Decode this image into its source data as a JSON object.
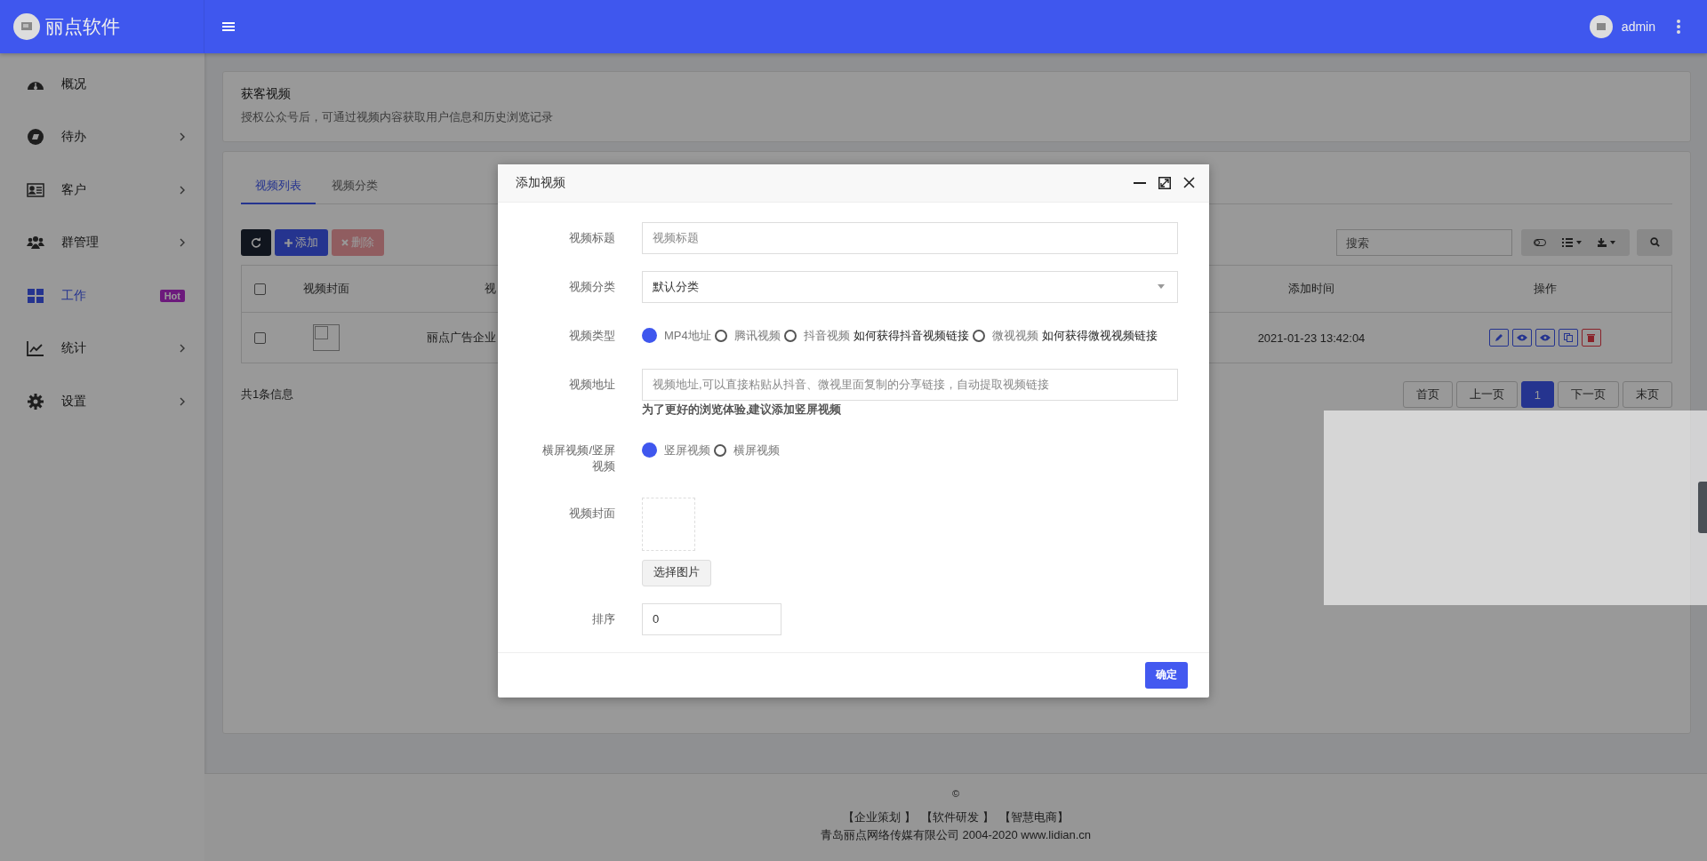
{
  "brand": {
    "name": "丽点软件"
  },
  "user": {
    "name": "admin"
  },
  "sidebar": {
    "items": [
      {
        "label": "概况",
        "kind": "gauge",
        "selected": false,
        "expandable": false
      },
      {
        "label": "待办",
        "kind": "compass",
        "selected": false,
        "expandable": true
      },
      {
        "label": "客户",
        "kind": "card",
        "selected": false,
        "expandable": true
      },
      {
        "label": "群管理",
        "kind": "users",
        "selected": false,
        "expandable": true
      },
      {
        "label": "工作",
        "kind": "grid",
        "selected": true,
        "expandable": false,
        "badge": "Hot"
      },
      {
        "label": "统计",
        "kind": "chart",
        "selected": false,
        "expandable": true
      },
      {
        "label": "设置",
        "kind": "gear",
        "selected": false,
        "expandable": true
      }
    ]
  },
  "page_header": {
    "title": "获客视频",
    "subtitle": "授权公众号后，可通过视频内容获取用户信息和历史浏览记录"
  },
  "tabs": [
    {
      "label": "视频列表",
      "selected": true
    },
    {
      "label": "视频分类",
      "selected": false
    }
  ],
  "toolbar": {
    "buttons": [
      {
        "kind": "refresh",
        "disabled": false
      },
      {
        "kind": "add",
        "label": "添加",
        "disabled": false
      },
      {
        "kind": "delete",
        "label": "删除",
        "disabled": true
      }
    ],
    "search": {
      "placeholder": "搜索"
    }
  },
  "table": {
    "all_selected": false,
    "columns": [
      "视频封面",
      "视",
      "添加时间",
      "操作"
    ],
    "rows": [
      {
        "selected": false,
        "title": "丽点广告企业",
        "added": "2021-01-23 13:42:04"
      }
    ]
  },
  "pagination": {
    "summary": "共1条信息",
    "pages": [
      {
        "label": "首页",
        "selected": false
      },
      {
        "label": "上一页",
        "selected": false
      },
      {
        "label": "1",
        "selected": true
      },
      {
        "label": "下一页",
        "selected": false
      },
      {
        "label": "末页",
        "selected": false
      }
    ]
  },
  "dialog": {
    "title": "添加视频",
    "fields": [
      {
        "kind": "text",
        "label": "视频标题",
        "placeholder": "视频标题"
      },
      {
        "kind": "select",
        "label": "视频分类",
        "value": "默认分类"
      },
      {
        "kind": "radio",
        "label": "视频类型",
        "options": [
          {
            "label": "MP4地址",
            "selected": true
          },
          {
            "label": "腾讯视频",
            "selected": false
          },
          {
            "label": "抖音视频",
            "selected": false,
            "help": "如何获得抖音视频链接"
          },
          {
            "label": "微视视频",
            "selected": false,
            "help": "如何获得微视视频链接"
          }
        ]
      },
      {
        "kind": "text",
        "label": "视频地址",
        "placeholder": "视频地址,可以直接粘贴从抖音、微视里面复制的分享链接，自动提取视频链接",
        "hint": "为了更好的浏览体验,建议添加竖屏视频"
      },
      {
        "kind": "radio",
        "label": "横屏视频/竖屏视频",
        "options": [
          {
            "label": "竖屏视频",
            "selected": true
          },
          {
            "label": "横屏视频",
            "selected": false
          }
        ]
      },
      {
        "kind": "upload",
        "label": "视频封面",
        "button": "选择图片"
      },
      {
        "kind": "number",
        "label": "排序",
        "value": "0"
      }
    ],
    "confirm": "确定"
  },
  "footer": {
    "copyright": "©",
    "links": [
      "【企业策划 】",
      "【软件研发 】",
      "【智慧电商】"
    ],
    "company": "青岛丽点网络传媒有限公司 2004-2020 www.lidian.cn"
  }
}
